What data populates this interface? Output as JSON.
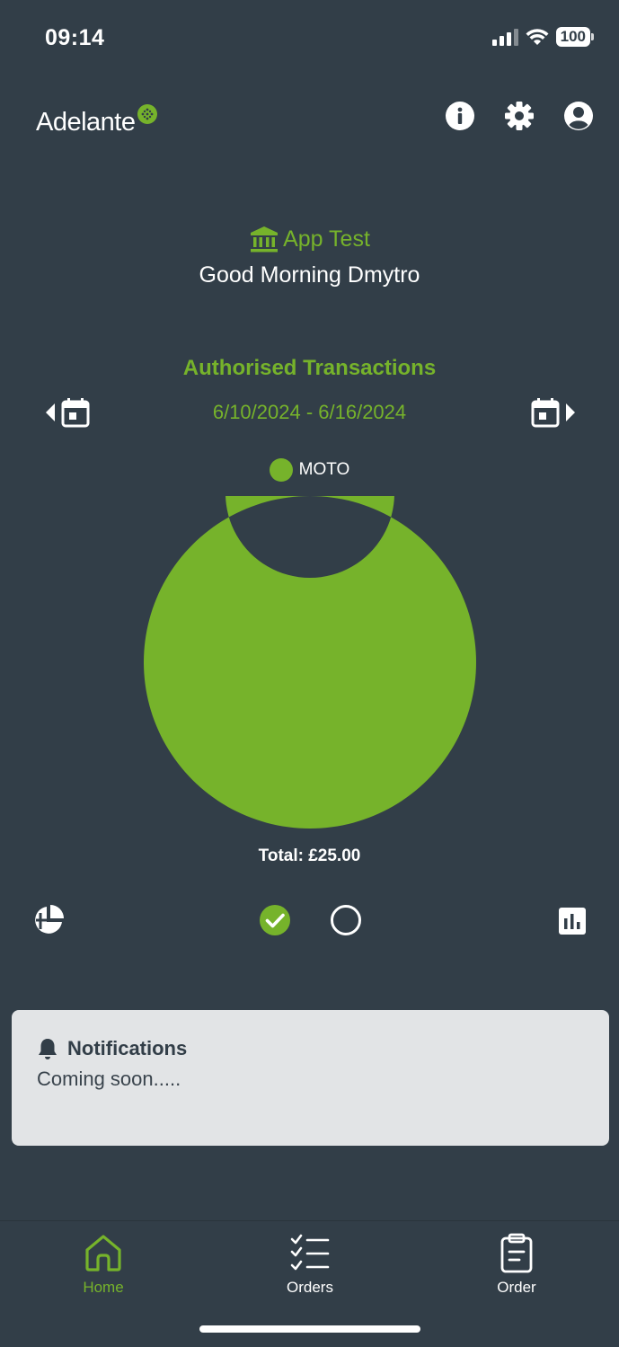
{
  "status_bar": {
    "time": "09:14",
    "battery": "100"
  },
  "header": {
    "logo_text": "Adelante",
    "icons": [
      "info-icon",
      "gear-icon",
      "account-icon"
    ]
  },
  "merchant": {
    "name": "App Test",
    "icon": "bank-icon"
  },
  "greeting": "Good Morning Dmytro",
  "transactions": {
    "title": "Authorised Transactions",
    "date_range": "6/10/2024 - 6/16/2024",
    "total_label": "Total: £25.00"
  },
  "chart_data": {
    "type": "pie",
    "categories": [
      "MOTO"
    ],
    "values": [
      25.0
    ],
    "legend": [
      "MOTO"
    ],
    "colors": [
      "#76b32b"
    ]
  },
  "notifications": {
    "title": "Notifications",
    "body": "Coming soon....."
  },
  "bottom_nav": {
    "items": [
      {
        "label": "Home",
        "icon": "home-icon",
        "active": true
      },
      {
        "label": "Orders",
        "icon": "orders-list-icon",
        "active": false
      },
      {
        "label": "Order",
        "icon": "clipboard-icon",
        "active": false
      }
    ]
  },
  "colors": {
    "background": "#323e48",
    "accent": "#76b32b",
    "card": "#e2e4e6"
  }
}
